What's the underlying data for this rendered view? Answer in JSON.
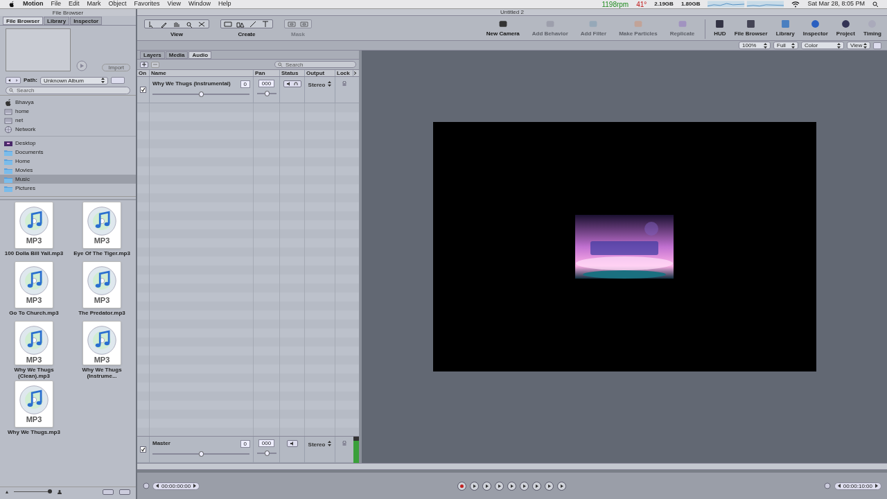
{
  "menu_bar": {
    "app": "Motion",
    "items": [
      "File",
      "Edit",
      "Mark",
      "Object",
      "Favorites",
      "View",
      "Window",
      "Help"
    ],
    "status": {
      "fan": "1198rpm",
      "temp": "41°",
      "memory_used": "2.19GB",
      "memory_free": "1.80GB",
      "clock": "Sat Mar 28, 8:05 PM"
    }
  },
  "file_browser": {
    "title": "File Browser",
    "tabs": [
      {
        "label": "File Browser",
        "selected": true
      },
      {
        "label": "Library",
        "selected": false
      },
      {
        "label": "Inspector",
        "selected": false
      }
    ],
    "import_button": "Import",
    "path_label": "Path:",
    "path": "Unknown Album",
    "search_placeholder": "Search",
    "devices": [
      {
        "label": "Bhavya",
        "kind": "computer",
        "selected": false
      },
      {
        "label": "home",
        "kind": "drive",
        "selected": false
      },
      {
        "label": "net",
        "kind": "drive",
        "selected": false
      },
      {
        "label": "Network",
        "kind": "network",
        "selected": false
      }
    ],
    "places": [
      {
        "label": "Desktop",
        "kind": "desktop",
        "selected": false
      },
      {
        "label": "Documents",
        "kind": "folder",
        "selected": false
      },
      {
        "label": "Home",
        "kind": "folder",
        "selected": false
      },
      {
        "label": "Movies",
        "kind": "folder",
        "selected": false
      },
      {
        "label": "Music",
        "kind": "folder",
        "selected": true
      },
      {
        "label": "Pictures",
        "kind": "folder",
        "selected": false
      }
    ],
    "icon_size": {
      "level": 0.95
    },
    "files": [
      {
        "name": "100 Dolla Bill Yall.mp3",
        "badge": "MP3"
      },
      {
        "name": "Eye Of The Tiger.mp3",
        "badge": "MP3"
      },
      {
        "name": "Go To Church.mp3",
        "badge": "MP3"
      },
      {
        "name": "The Predator.mp3",
        "badge": "MP3"
      },
      {
        "name": "Why We Thugs (Clean).mp3",
        "badge": "MP3"
      },
      {
        "name": "Why We Thugs (Instrume...",
        "badge": "MP3"
      },
      {
        "name": "Why We Thugs.mp3",
        "badge": "MP3"
      }
    ]
  },
  "editor": {
    "title": "Untitled 2",
    "tool_groups": [
      {
        "label": "View",
        "disabled": false
      },
      {
        "label": "Create",
        "disabled": false
      },
      {
        "label": "Mask",
        "disabled": true
      }
    ],
    "actions": [
      {
        "label": "New Camera",
        "disabled": false
      },
      {
        "label": "Add Behavior",
        "disabled": true
      },
      {
        "label": "Add Filter",
        "disabled": true
      },
      {
        "label": "Make Particles",
        "disabled": true
      },
      {
        "label": "Replicate",
        "disabled": true
      }
    ],
    "windows": [
      {
        "label": "HUD"
      },
      {
        "label": "File Browser"
      },
      {
        "label": "Library"
      },
      {
        "label": "Inspector"
      },
      {
        "label": "Project"
      },
      {
        "label": "Timing"
      }
    ],
    "view_controls": [
      "100%",
      "Full",
      "Color",
      "View"
    ]
  },
  "audio_panel": {
    "tabs": [
      {
        "label": "Layers",
        "selected": false
      },
      {
        "label": "Media",
        "selected": false
      },
      {
        "label": "Audio",
        "selected": true
      }
    ],
    "search_placeholder": "Search",
    "columns": [
      "On",
      "Name",
      "Pan",
      "Status",
      "Output",
      "Lock"
    ],
    "tracks": [
      {
        "name": "Why We Thugs (Instrumental)",
        "on": true,
        "volume": {
          "value": "0",
          "level": 0.5
        },
        "pan": {
          "value": "000",
          "level": 0.5
        },
        "output": "Stereo",
        "solo_button": true
      }
    ],
    "master": {
      "name": "Master",
      "on": true,
      "volume": {
        "value": "0",
        "level": 0.5
      },
      "pan": {
        "value": "000",
        "level": 0.5
      },
      "output": "Stereo",
      "meter": {
        "level": 0.85
      }
    }
  },
  "transport": {
    "start_time": "00:00:00:00",
    "end_time": "00:00:10:00"
  }
}
